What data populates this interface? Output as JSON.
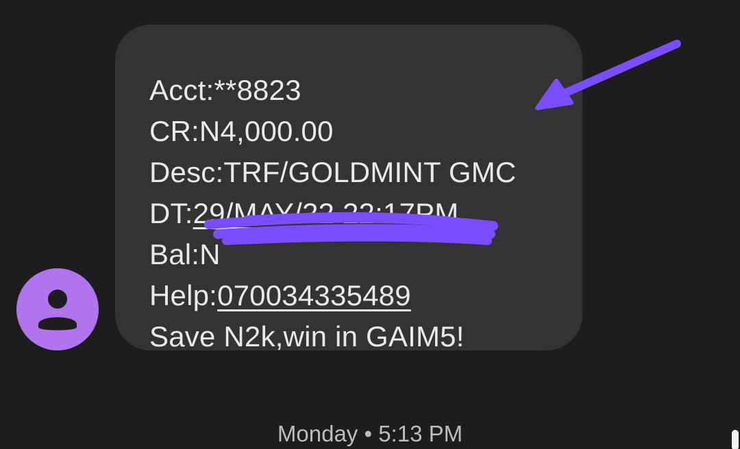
{
  "message": {
    "lines": {
      "acct": "Acct:**8823",
      "cr": "CR:N4,000.00",
      "desc": "Desc:TRF/GOLDMINT GMC",
      "dt_label": "DT:",
      "dt_value": "29/MAY/22 22:17PM",
      "bal_label": "Bal:N",
      "help_label": "Help:",
      "help_value": "070034335489",
      "promo": "Save N2k,win in GAIM5!"
    }
  },
  "timestamp": "Monday • 5:13 PM",
  "avatar": {
    "icon": "person-icon",
    "color": "#b274ee"
  },
  "annotations": {
    "color": "#7b4dff"
  },
  "colors": {
    "background": "#1d1d20",
    "bubble": "#333335",
    "text": "#e9e9e9",
    "timestamp": "#bdbdbd"
  }
}
